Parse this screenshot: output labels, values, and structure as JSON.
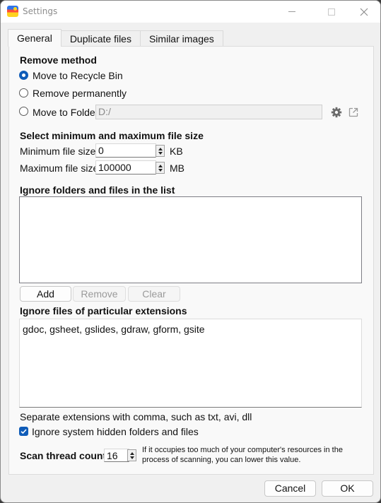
{
  "window": {
    "title": "Settings",
    "icon": "app-logo-icon",
    "controls": {
      "minimize": "minimize-icon",
      "maximize": "maximize-icon",
      "close": "close-icon"
    }
  },
  "tabs": [
    {
      "label": "General",
      "active": true
    },
    {
      "label": "Duplicate files",
      "active": false
    },
    {
      "label": "Similar images",
      "active": false
    }
  ],
  "remove_method": {
    "heading": "Remove method",
    "options": [
      {
        "label": "Move to Recycle Bin",
        "selected": true
      },
      {
        "label": "Remove permanently",
        "selected": false
      },
      {
        "label": "Move to Folder",
        "selected": false
      }
    ],
    "folder_value": "D:/",
    "folder_settings_icon": "gear-icon",
    "folder_open_icon": "open-external-icon"
  },
  "file_size": {
    "heading": "Select minimum and maximum file size",
    "min_label": "Minimum file size",
    "min_value": "0",
    "min_unit": "KB",
    "max_label": "Maximum file size",
    "max_value": "100000",
    "max_unit": "MB"
  },
  "ignore_list": {
    "heading": "Ignore folders and files in the list",
    "items": [],
    "buttons": {
      "add": "Add",
      "remove": "Remove",
      "clear": "Clear"
    }
  },
  "ignore_extensions": {
    "heading": "Ignore files of particular extensions",
    "value": "gdoc, gsheet, gslides, gdraw, gform, gsite",
    "hint": "Separate extensions with comma, such as txt, avi, dll"
  },
  "ignore_hidden": {
    "label": "Ignore system hidden folders and files",
    "checked": true
  },
  "scan_threads": {
    "label": "Scan thread count",
    "value": "16",
    "hint_line1": "If it occupies too much of your computer's resources in the",
    "hint_line2": "process of scanning, you can lower this value."
  },
  "footer": {
    "cancel": "Cancel",
    "ok": "OK"
  },
  "colors": {
    "accent": "#0f5cb8"
  }
}
